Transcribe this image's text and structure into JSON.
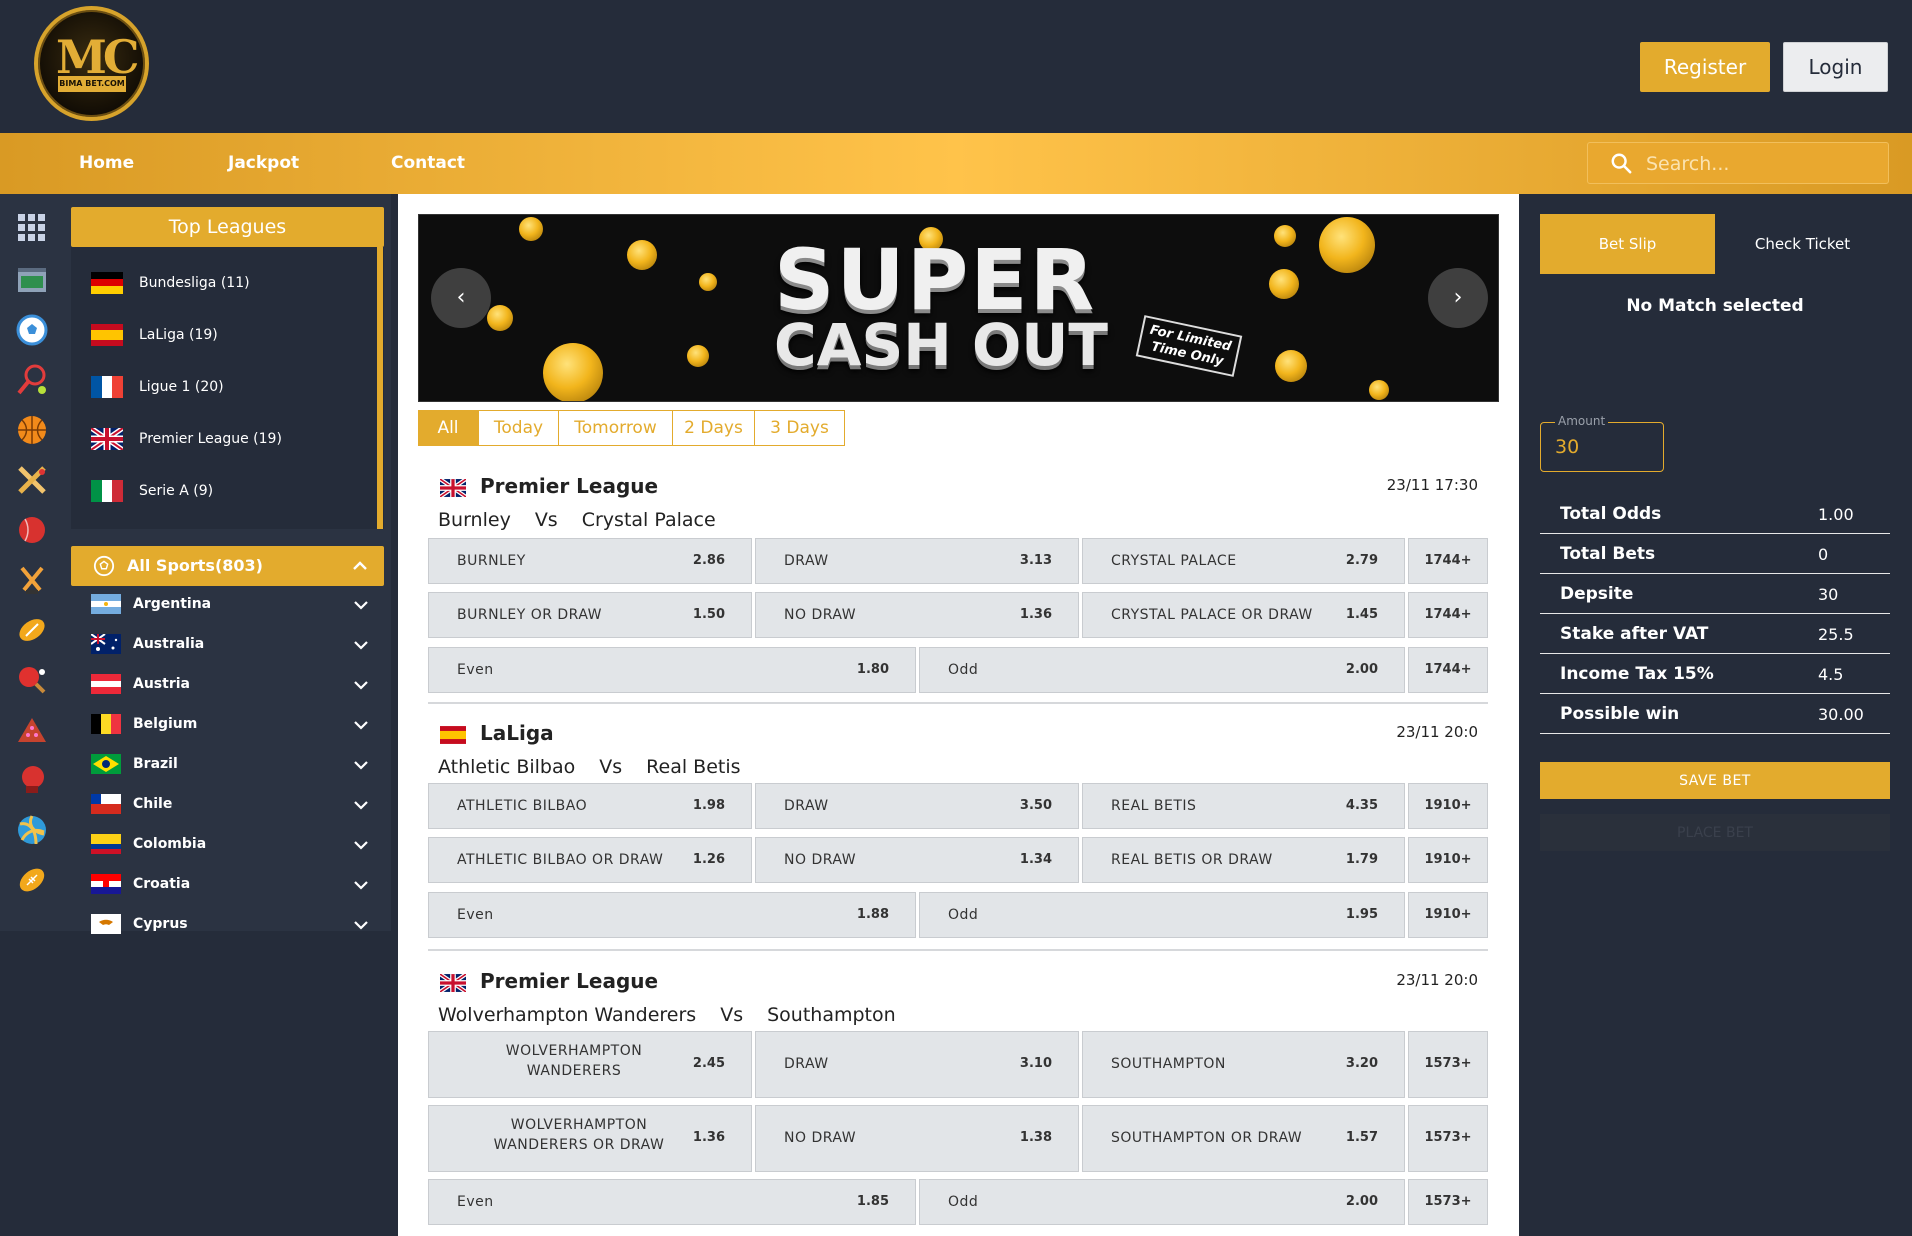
{
  "brand": {
    "logo_mono": "MC",
    "logo_text": "BIMA BET.COM"
  },
  "header": {
    "register_label": "Register",
    "login_label": "Login"
  },
  "nav": {
    "items": [
      "Home",
      "Jackpot",
      "Contact"
    ],
    "search_placeholder": "Search..."
  },
  "sport_icons": [
    "grid-icon",
    "stadium-icon",
    "football-icon",
    "tennis-icon",
    "basketball-icon",
    "cricket-icon",
    "cricket-ball-icon",
    "hockey-icon",
    "rugby-icon",
    "table-tennis-icon",
    "snooker-icon",
    "boxing-icon",
    "volleyball-icon",
    "american-football-icon"
  ],
  "top_leagues": {
    "title": "Top Leagues",
    "items": [
      {
        "label": "Bundesliga (11)",
        "flag": "germany"
      },
      {
        "label": "LaLiga (19)",
        "flag": "spain"
      },
      {
        "label": "Ligue 1 (20)",
        "flag": "france"
      },
      {
        "label": "Premier League (19)",
        "flag": "uk"
      },
      {
        "label": "Serie A (9)",
        "flag": "italy"
      }
    ]
  },
  "all_sports": {
    "title": "All Sports(803)",
    "countries": [
      {
        "label": "Argentina",
        "flag": "argentina"
      },
      {
        "label": "Australia",
        "flag": "australia"
      },
      {
        "label": "Austria",
        "flag": "austria"
      },
      {
        "label": "Belgium",
        "flag": "belgium"
      },
      {
        "label": "Brazil",
        "flag": "brazil"
      },
      {
        "label": "Chile",
        "flag": "chile"
      },
      {
        "label": "Colombia",
        "flag": "colombia"
      },
      {
        "label": "Croatia",
        "flag": "croatia"
      },
      {
        "label": "Cyprus",
        "flag": "cyprus"
      }
    ]
  },
  "banner": {
    "line1": "SUPER",
    "line2": "CASH OUT",
    "badge": "For Limited Time Only"
  },
  "filters": {
    "tabs": [
      "All",
      "Today",
      "Tomorrow",
      "2 Days",
      "3 Days"
    ],
    "active": "All"
  },
  "matches": [
    {
      "league": "Premier League",
      "flag": "uk",
      "time": "23/11 17:30",
      "home": "Burnley",
      "vs": "Vs",
      "away": "Crystal Palace",
      "row1": [
        [
          "BURNLEY",
          "2.86"
        ],
        [
          "DRAW",
          "3.13"
        ],
        [
          "CRYSTAL PALACE",
          "2.79"
        ]
      ],
      "row2": [
        [
          "BURNLEY OR DRAW",
          "1.50"
        ],
        [
          "NO DRAW",
          "1.36"
        ],
        [
          "CRYSTAL PALACE OR DRAW",
          "1.45"
        ]
      ],
      "row3": [
        [
          "Even",
          "1.80"
        ],
        [
          "Odd",
          "2.00"
        ]
      ],
      "more": "1744+"
    },
    {
      "league": "LaLiga",
      "flag": "spain",
      "time": "23/11 20:0",
      "home": "Athletic Bilbao",
      "vs": "Vs",
      "away": "Real Betis",
      "row1": [
        [
          "ATHLETIC BILBAO",
          "1.98"
        ],
        [
          "DRAW",
          "3.50"
        ],
        [
          "REAL BETIS",
          "4.35"
        ]
      ],
      "row2": [
        [
          "ATHLETIC BILBAO OR DRAW",
          "1.26"
        ],
        [
          "NO DRAW",
          "1.34"
        ],
        [
          "REAL BETIS OR DRAW",
          "1.79"
        ]
      ],
      "row3": [
        [
          "Even",
          "1.88"
        ],
        [
          "Odd",
          "1.95"
        ]
      ],
      "more": "1910+"
    },
    {
      "league": "Premier League",
      "flag": "uk",
      "time": "23/11 20:0",
      "home": "Wolverhampton Wanderers",
      "vs": "Vs",
      "away": "Southampton",
      "row1": [
        [
          "WOLVERHAMPTON WANDERERS",
          "2.45"
        ],
        [
          "DRAW",
          "3.10"
        ],
        [
          "SOUTHAMPTON",
          "3.20"
        ]
      ],
      "row2": [
        [
          "WOLVERHAMPTON WANDERERS OR DRAW",
          "1.36"
        ],
        [
          "NO DRAW",
          "1.38"
        ],
        [
          "SOUTHAMPTON OR DRAW",
          "1.57"
        ]
      ],
      "row3": [
        [
          "Even",
          "1.85"
        ],
        [
          "Odd",
          "2.00"
        ]
      ],
      "more": "1573+"
    }
  ],
  "betslip": {
    "tabs": [
      "Bet Slip",
      "Check Ticket"
    ],
    "empty_text": "No Match selected",
    "amount_label": "Amount",
    "amount_value": "30",
    "summary": [
      {
        "k": "Total Odds",
        "v": "1.00"
      },
      {
        "k": "Total Bets",
        "v": "0"
      },
      {
        "k": "Depsite",
        "v": "30"
      },
      {
        "k": "Stake after VAT",
        "v": "25.5"
      },
      {
        "k": "Income Tax 15%",
        "v": "4.5"
      },
      {
        "k": "Possible win",
        "v": "30.00"
      }
    ],
    "save_label": "SAVE BET",
    "place_label": "PLACE BET"
  },
  "colors": {
    "accent": "#e3ab2d",
    "background": "#252c3a",
    "panel": "#2b3342",
    "cell": "#e2e5e8"
  }
}
